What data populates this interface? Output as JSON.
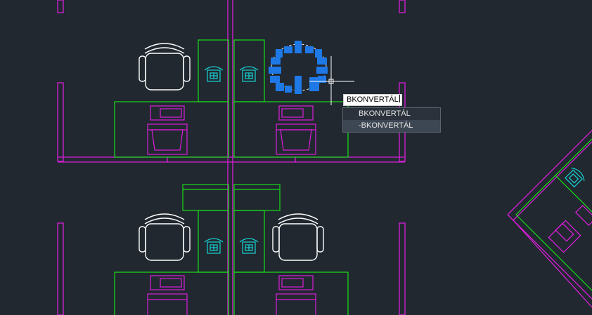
{
  "command_line": {
    "typed_text": "BKONVERTÁL"
  },
  "autocomplete": {
    "items": [
      {
        "label": "BKONVERTÁL"
      },
      {
        "label": "-BKONVERTÁL"
      }
    ],
    "selected_index": 1
  },
  "colors": {
    "background": "#212830",
    "walls": "#d91ed9",
    "desks": "#16e016",
    "chairs": "#ffffff",
    "phones": "#17d4d4",
    "selection_grips": "#1e78e6",
    "crosshair": "#ffffff"
  },
  "drawing": {
    "objects": [
      "office-chair",
      "desk",
      "telephone",
      "partition-wall",
      "selected-block"
    ]
  }
}
